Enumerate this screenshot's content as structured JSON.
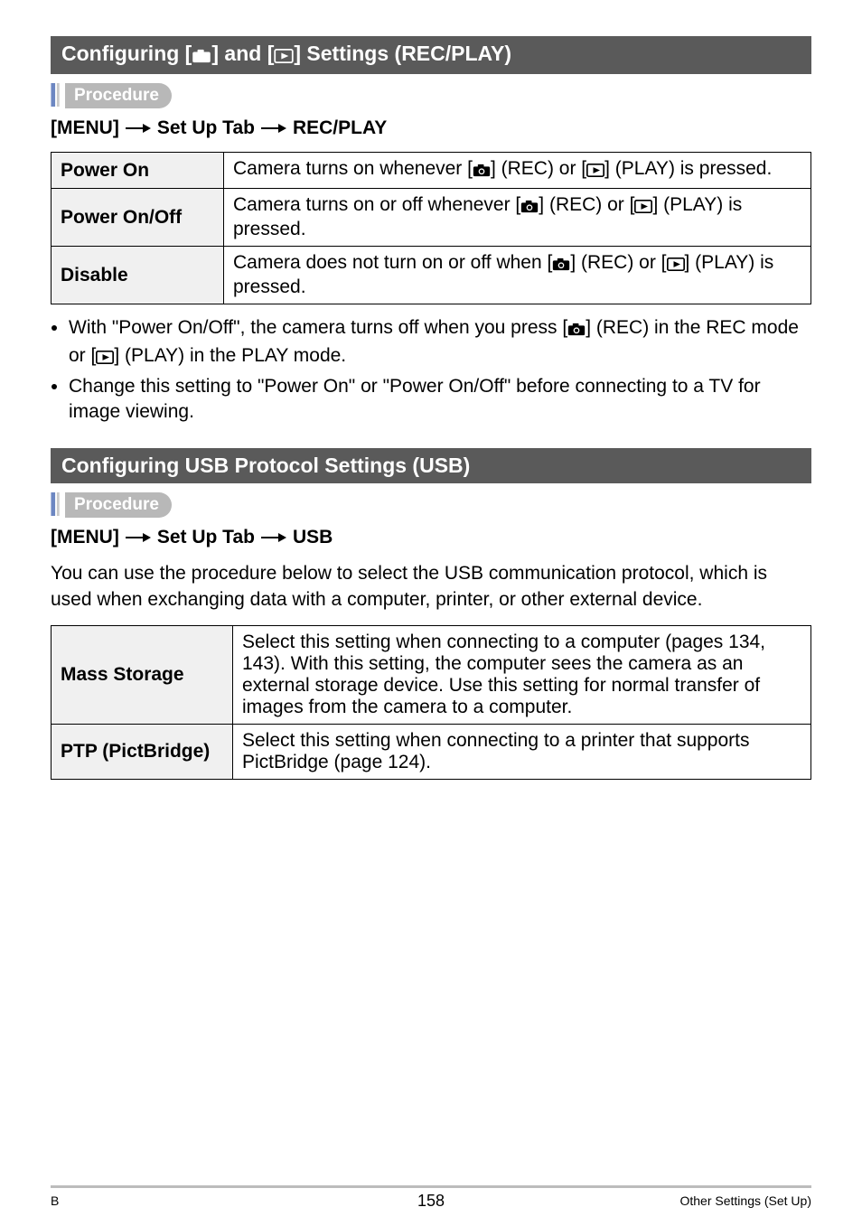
{
  "section1": {
    "title_pre": "Configuring [",
    "title_mid": "] and [",
    "title_post": "] Settings (REC/PLAY)",
    "procedure_label": "Procedure",
    "nav": {
      "a": "[MENU]",
      "b": "Set Up Tab",
      "c": "REC/PLAY"
    },
    "rows": [
      {
        "key": "Power On",
        "val_parts": [
          "Camera turns on whenever [",
          "] (REC) or [",
          "] (PLAY) is pressed."
        ]
      },
      {
        "key": "Power On/Off",
        "val_parts": [
          "Camera turns on or off whenever [",
          "] (REC) or [",
          "] (PLAY) is pressed."
        ]
      },
      {
        "key": "Disable",
        "val_parts": [
          "Camera does not turn on or off when [",
          "] (REC) or [",
          "] (PLAY) is pressed."
        ]
      }
    ],
    "bullets": [
      {
        "parts": [
          "With \"Power On/Off\", the camera turns off when you press [",
          "] (REC) in the REC mode or [",
          "] (PLAY) in the PLAY mode."
        ]
      },
      {
        "text": "Change this setting to \"Power On\" or \"Power On/Off\" before connecting to a TV for image viewing."
      }
    ]
  },
  "section2": {
    "title": "Configuring USB Protocol Settings (USB)",
    "procedure_label": "Procedure",
    "nav": {
      "a": "[MENU]",
      "b": "Set Up Tab",
      "c": "USB"
    },
    "intro": "You can use the procedure below to select the USB communication protocol, which is used when exchanging data with a computer, printer, or other external device.",
    "rows": [
      {
        "key": "Mass Storage",
        "val": "Select this setting when connecting to a computer (pages 134, 143). With this setting, the computer sees the camera as an external storage device. Use this setting for normal transfer of images from the camera to a computer."
      },
      {
        "key": "PTP (PictBridge)",
        "val": "Select this setting when connecting to a printer that supports PictBridge (page 124)."
      }
    ]
  },
  "footer": {
    "left": "B",
    "center": "158",
    "right": "Other Settings (Set Up)"
  }
}
